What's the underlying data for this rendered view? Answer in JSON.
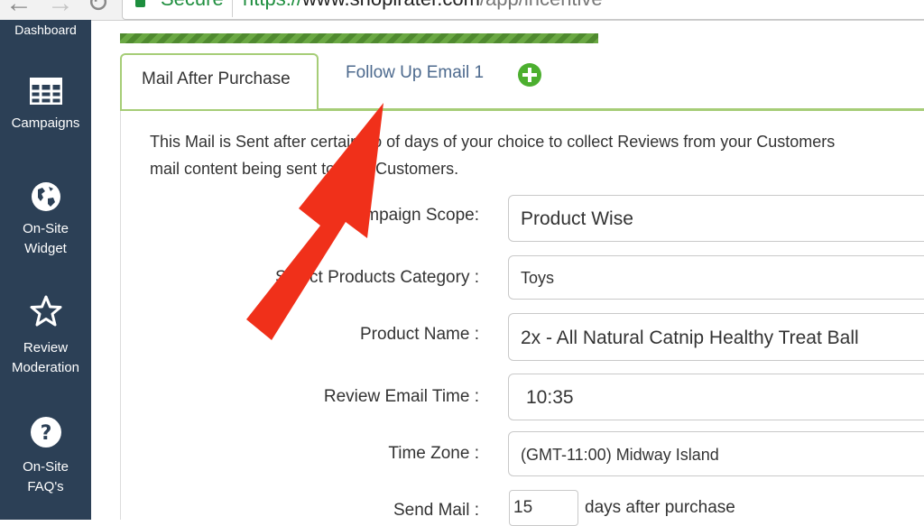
{
  "browser": {
    "secure_label": "Secure",
    "url_scheme": "https://",
    "url_host": "www.shopirater.com",
    "url_path": "/app/incentive"
  },
  "sidebar": {
    "items": [
      {
        "label": "Dashboard",
        "icon": "dashboard-icon"
      },
      {
        "label": "Campaigns",
        "icon": "table-grid-icon"
      },
      {
        "label": "On-Site\nWidget",
        "icon": "globe-icon"
      },
      {
        "label": "Review\nModeration",
        "icon": "star-icon"
      },
      {
        "label": "On-Site\nFAQ's",
        "icon": "question-circle-icon"
      }
    ]
  },
  "tabs": {
    "active": "Mail After Purchase",
    "inactive": "Follow Up Email 1",
    "add_icon": "plus-circle-icon",
    "accent_color": "#4caf2f"
  },
  "content": {
    "description_line1": "This Mail is Sent after certain no of days of your choice to collect Reviews from your Customers",
    "description_line2": "mail content being sent to your Customers."
  },
  "form": {
    "campaign_scope_label": "Campaign Scope:",
    "campaign_scope_value": "Product Wise",
    "category_label": "Select Products Category :",
    "category_value": "Toys",
    "product_name_label": "Product Name :",
    "product_name_value": "2x - All Natural Catnip Healthy Treat Ball",
    "email_time_label": "Review Email Time :",
    "email_time_value": "10:35",
    "timezone_label": "Time Zone :",
    "timezone_value": "(GMT-11:00) Midway Island",
    "send_mail_label": "Send Mail :",
    "send_mail_value": "15",
    "send_mail_suffix": "days after purchase"
  },
  "annotation": {
    "arrow_color": "#f0301a"
  }
}
